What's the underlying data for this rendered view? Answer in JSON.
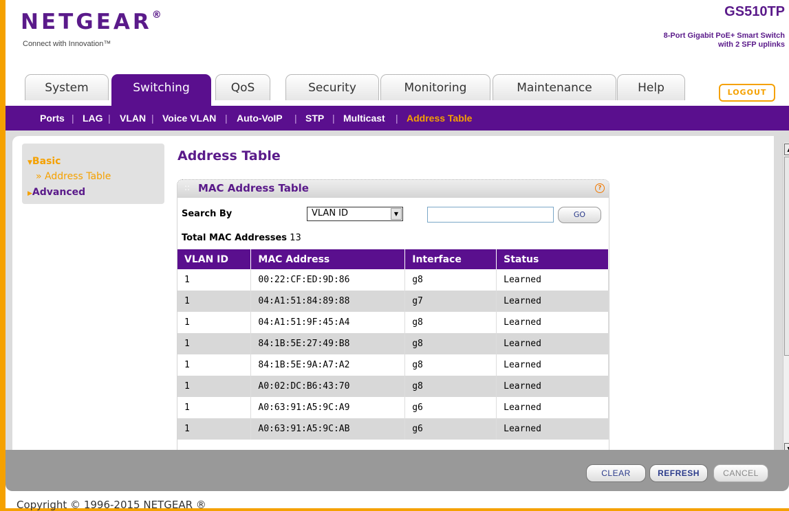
{
  "header": {
    "logo": "NETGEAR",
    "logo_mark": "®",
    "tagline": "Connect with Innovation™",
    "model": "GS510TP",
    "subtitle_line1": "8-Port Gigabit PoE+ Smart Switch",
    "subtitle_line2": "with 2 SFP uplinks"
  },
  "tabs": [
    {
      "label": "System"
    },
    {
      "label": "Switching"
    },
    {
      "label": "QoS"
    },
    {
      "label": "Security"
    },
    {
      "label": "Monitoring"
    },
    {
      "label": "Maintenance"
    },
    {
      "label": "Help"
    }
  ],
  "active_tab": "Switching",
  "logout_label": "LOGOUT",
  "subnav": [
    {
      "label": "Ports"
    },
    {
      "label": "LAG"
    },
    {
      "label": "VLAN"
    },
    {
      "label": "Voice VLAN"
    },
    {
      "label": "Auto-VoIP"
    },
    {
      "label": "STP"
    },
    {
      "label": "Multicast"
    },
    {
      "label": "Address Table"
    }
  ],
  "active_subnav": "Address Table",
  "leftnav": {
    "basic": "Basic",
    "basic_item": "» Address Table",
    "advanced": "Advanced"
  },
  "page_title": "Address Table",
  "panel": {
    "title": "MAC Address Table",
    "search_label": "Search By",
    "search_by_value": "VLAN ID",
    "search_value": "",
    "go_label": "GO",
    "total_label": "Total MAC Addresses",
    "total_value": "13"
  },
  "table": {
    "headers": [
      "VLAN ID",
      "MAC Address",
      "Interface",
      "Status"
    ],
    "rows": [
      [
        "1",
        "00:22:CF:ED:9D:86",
        "g8",
        "Learned"
      ],
      [
        "1",
        "04:A1:51:84:89:88",
        "g7",
        "Learned"
      ],
      [
        "1",
        "04:A1:51:9F:45:A4",
        "g8",
        "Learned"
      ],
      [
        "1",
        "84:1B:5E:27:49:B8",
        "g8",
        "Learned"
      ],
      [
        "1",
        "84:1B:5E:9A:A7:A2",
        "g8",
        "Learned"
      ],
      [
        "1",
        "A0:02:DC:B6:43:70",
        "g8",
        "Learned"
      ],
      [
        "1",
        "A0:63:91:A5:9C:A9",
        "g6",
        "Learned"
      ],
      [
        "1",
        "A0:63:91:A5:9C:AB",
        "g6",
        "Learned"
      ]
    ]
  },
  "buttons": {
    "clear": "CLEAR",
    "refresh": "REFRESH",
    "cancel": "CANCEL"
  },
  "copyright": "Copyright © 1996-2015 NETGEAR ®",
  "colors": {
    "brand_purple": "#5a0f8e",
    "accent_orange": "#f5a100"
  }
}
